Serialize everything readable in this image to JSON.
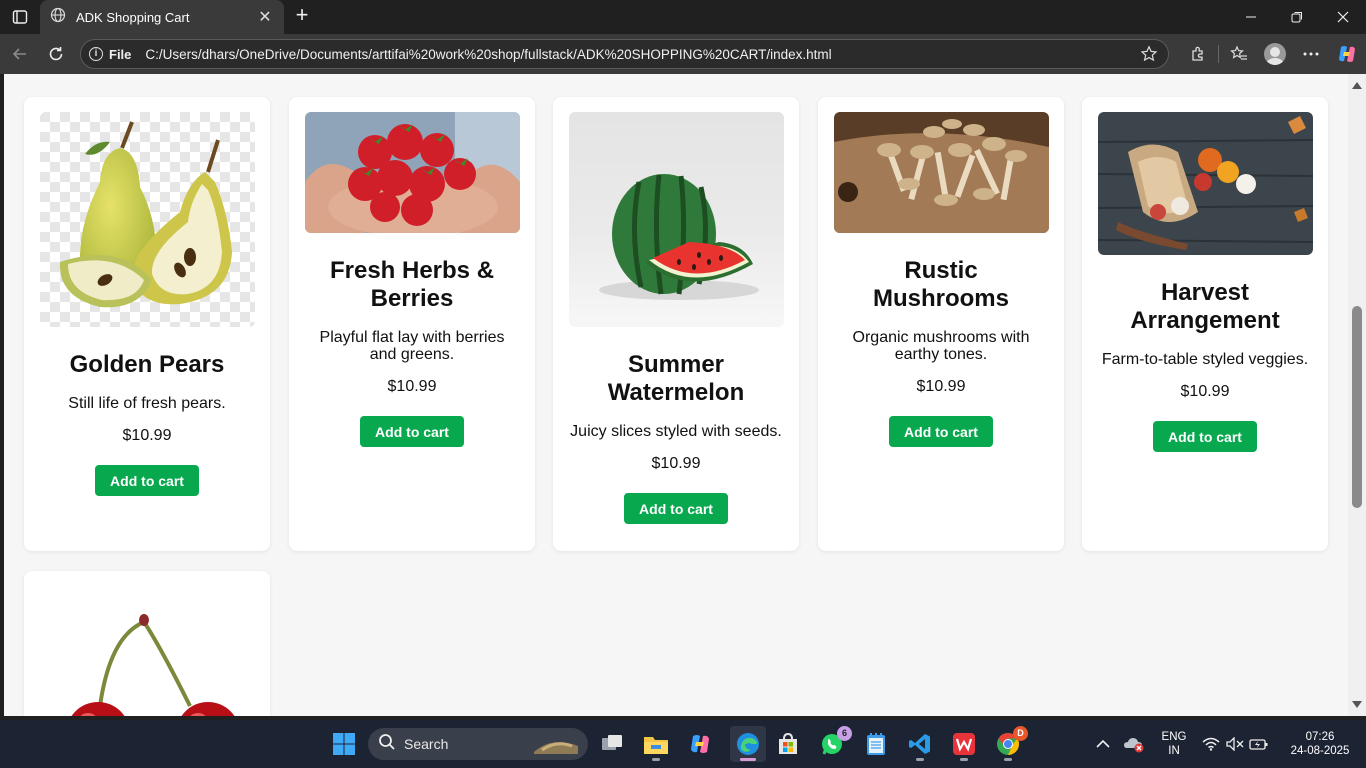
{
  "browser": {
    "tab_title": "ADK Shopping Cart",
    "omnibox": {
      "scheme_label": "File",
      "url": "C:/Users/dhars/OneDrive/Documents/arttifai%20work%20shop/fullstack/ADK%20SHOPPING%20CART/index.html"
    }
  },
  "products": [
    {
      "name": "Golden Pears",
      "description": "Still life of fresh pears.",
      "price": "$10.99",
      "button": "Add to cart",
      "image": "pears-image"
    },
    {
      "name": "Fresh Herbs & Berries",
      "description": "Playful flat lay with berries and greens.",
      "price": "$10.99",
      "button": "Add to cart",
      "image": "strawberries-image"
    },
    {
      "name": "Summer Watermelon",
      "description": "Juicy slices styled with seeds.",
      "price": "$10.99",
      "button": "Add to cart",
      "image": "watermelon-image"
    },
    {
      "name": "Rustic Mushrooms",
      "description": "Organic mushrooms with earthy tones.",
      "price": "$10.99",
      "button": "Add to cart",
      "image": "mushrooms-image"
    },
    {
      "name": "Harvest Arrangement",
      "description": "Farm-to-table styled veggies.",
      "price": "$10.99",
      "button": "Add to cart",
      "image": "harvest-image"
    },
    {
      "image": "cherries-image"
    }
  ],
  "taskbar": {
    "search_label": "Search",
    "whatsapp_badge": "6",
    "language": "ENG",
    "region": "IN",
    "time": "07:26",
    "date": "24-08-2025"
  },
  "colors": {
    "button_green": "#08a84e",
    "page_bg": "#f6f6f6",
    "chrome_dark": "#202020",
    "taskbar_bg": "#1c2333"
  }
}
